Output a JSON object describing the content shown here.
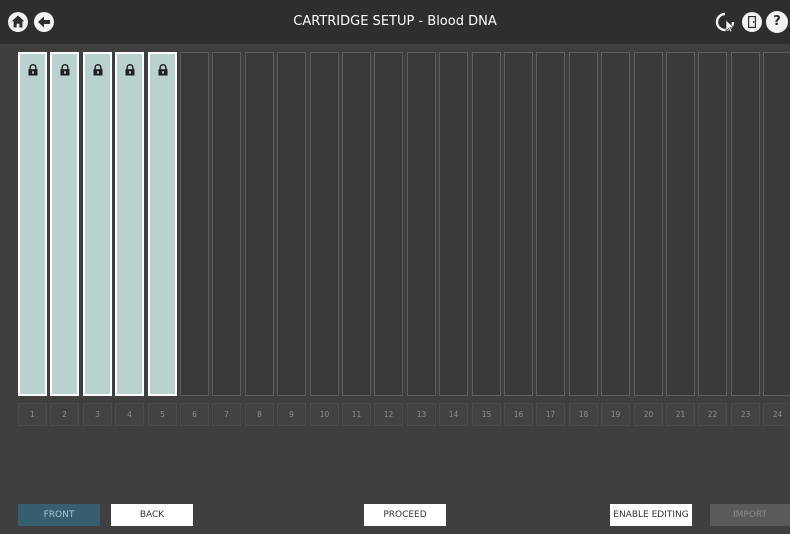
{
  "header": {
    "title": "CARTRIDGE SETUP - Blood DNA",
    "left_icons": [
      "home-icon",
      "back-arrow-icon"
    ],
    "right_icons": [
      "refresh-cursor-icon",
      "exit-door-icon",
      "help-icon"
    ],
    "help_glyph": "?"
  },
  "slots": [
    {
      "number": "1",
      "filled": true,
      "locked": true
    },
    {
      "number": "2",
      "filled": true,
      "locked": true
    },
    {
      "number": "3",
      "filled": true,
      "locked": true
    },
    {
      "number": "4",
      "filled": true,
      "locked": true
    },
    {
      "number": "5",
      "filled": true,
      "locked": true
    },
    {
      "number": "6",
      "filled": false,
      "locked": false
    },
    {
      "number": "7",
      "filled": false,
      "locked": false
    },
    {
      "number": "8",
      "filled": false,
      "locked": false
    },
    {
      "number": "9",
      "filled": false,
      "locked": false
    },
    {
      "number": "10",
      "filled": false,
      "locked": false
    },
    {
      "number": "11",
      "filled": false,
      "locked": false
    },
    {
      "number": "12",
      "filled": false,
      "locked": false
    },
    {
      "number": "13",
      "filled": false,
      "locked": false
    },
    {
      "number": "14",
      "filled": false,
      "locked": false
    },
    {
      "number": "15",
      "filled": false,
      "locked": false
    },
    {
      "number": "16",
      "filled": false,
      "locked": false
    },
    {
      "number": "17",
      "filled": false,
      "locked": false
    },
    {
      "number": "18",
      "filled": false,
      "locked": false
    },
    {
      "number": "19",
      "filled": false,
      "locked": false
    },
    {
      "number": "20",
      "filled": false,
      "locked": false
    },
    {
      "number": "21",
      "filled": false,
      "locked": false
    },
    {
      "number": "22",
      "filled": false,
      "locked": false
    },
    {
      "number": "23",
      "filled": false,
      "locked": false
    },
    {
      "number": "24",
      "filled": false,
      "locked": false
    }
  ],
  "buttons": {
    "front": "FRONT",
    "back": "BACK",
    "proceed": "PROCEED",
    "enable_editing": "ENABLE EDITING",
    "import": "IMPORT"
  },
  "colors": {
    "filled_slot": "#b9d1cf",
    "active_button": "#365e6e"
  }
}
